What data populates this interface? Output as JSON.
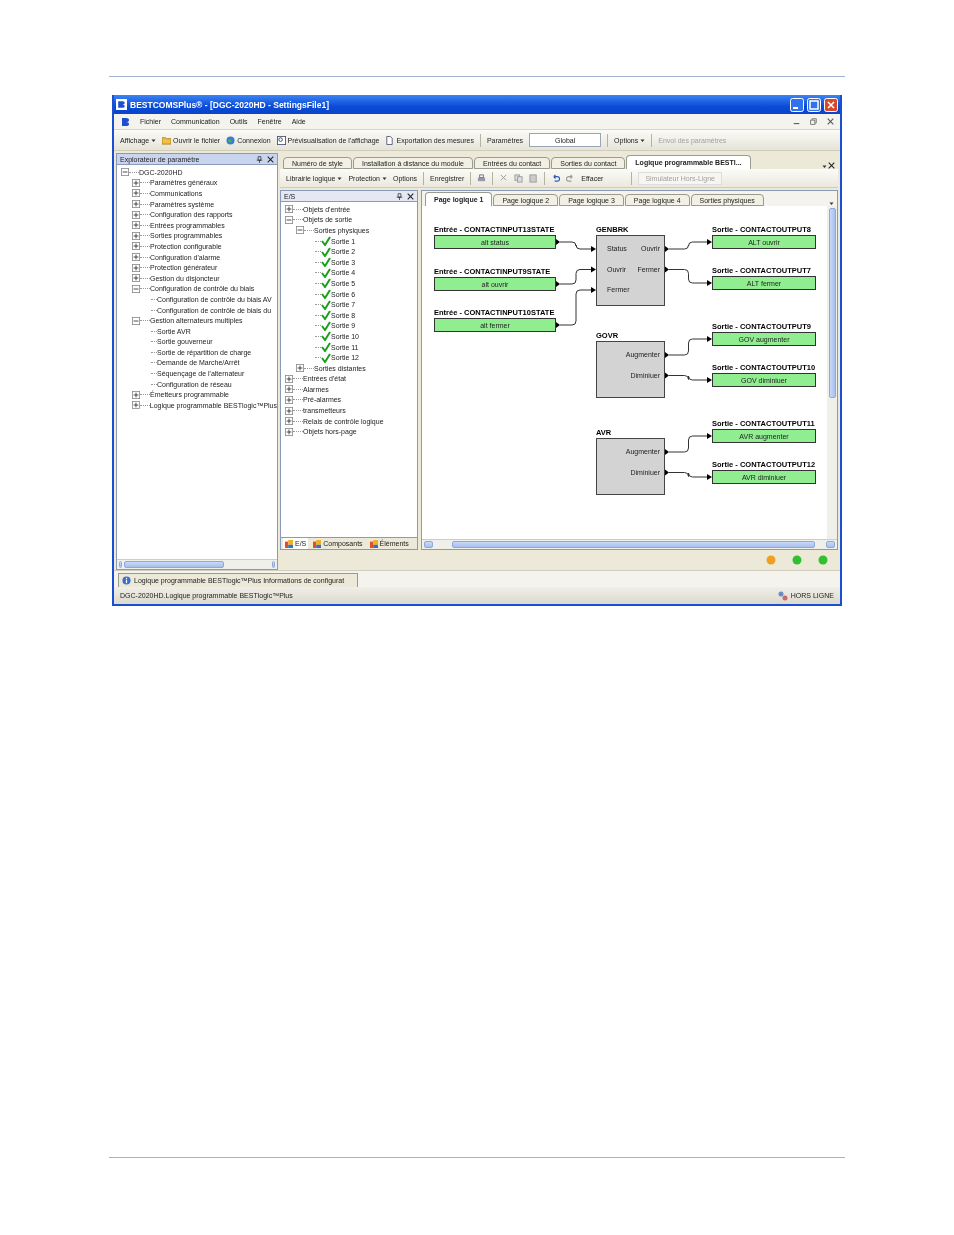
{
  "window": {
    "title": "BESTCOMSPlus® - [DGC-2020HD - SettingsFile1]"
  },
  "menu": [
    "Fichier",
    "Communication",
    "Outils",
    "Fenêtre",
    "Aide"
  ],
  "toolbar": [
    {
      "kind": "dropdown",
      "label": "Affichage"
    },
    {
      "kind": "button",
      "label": "Ouvrir le fichier"
    },
    {
      "kind": "button",
      "label": "Connexion"
    },
    {
      "kind": "button",
      "label": "Prévisualisation de l'affichage"
    },
    {
      "kind": "button",
      "label": "Exportation des mesures"
    },
    {
      "kind": "label",
      "label": "Paramètres"
    },
    {
      "kind": "field",
      "value": "Global"
    },
    {
      "kind": "dropdown",
      "label": "Options"
    },
    {
      "kind": "disabled",
      "label": "Envoi des paramètres"
    }
  ],
  "explorer": {
    "title": "Explorateur de paramètre",
    "tree": [
      {
        "label": "DGC-2020HD",
        "expanded": true,
        "children": [
          {
            "label": "Paramètres généraux",
            "expanded": false
          },
          {
            "label": "Communications",
            "expanded": false
          },
          {
            "label": "Paramètres système",
            "expanded": false
          },
          {
            "label": "Configuration des rapports",
            "expanded": false
          },
          {
            "label": "Entrées programmables",
            "expanded": false
          },
          {
            "label": "Sorties programmables",
            "expanded": false
          },
          {
            "label": "Protection configurable",
            "expanded": false
          },
          {
            "label": "Configuration d'alarme",
            "expanded": false
          },
          {
            "label": "Protection générateur",
            "expanded": false
          },
          {
            "label": "Gestion du disjoncteur",
            "expanded": false
          },
          {
            "label": "Configuration de contrôle du biais",
            "expanded": true,
            "children": [
              {
                "label": "Configuration de contrôle du biais AV"
              },
              {
                "label": "Configuration de contrôle de biais du"
              }
            ]
          },
          {
            "label": "Gestion alternateurs multiples",
            "expanded": true,
            "children": [
              {
                "label": "Sortie AVR"
              },
              {
                "label": "Sortie gouverneur"
              },
              {
                "label": "Sortie de répartition de charge"
              },
              {
                "label": "Demande de Marche/Arrêt"
              },
              {
                "label": "Séquençage de l'alternateur"
              },
              {
                "label": "Configuration de réseau"
              }
            ]
          },
          {
            "label": "Émetteurs programmable",
            "expanded": false
          },
          {
            "label": "Logique programmable BESTlogic™Plus",
            "expanded": false
          }
        ]
      }
    ]
  },
  "doc_tabs": [
    {
      "label": "Numéro de style",
      "selected": false
    },
    {
      "label": "Installation à distance du module",
      "selected": false
    },
    {
      "label": "Entrées du contact",
      "selected": false
    },
    {
      "label": "Sorties du contact",
      "selected": false
    },
    {
      "label": "Logique programmable BESTl...",
      "selected": true
    }
  ],
  "doc_toolbar": [
    {
      "kind": "dropdown",
      "label": "Librairie logique"
    },
    {
      "kind": "dropdown",
      "label": "Protection"
    },
    {
      "kind": "button",
      "label": "Options"
    },
    {
      "kind": "button",
      "label": "Enregistrer"
    },
    {
      "kind": "icons"
    },
    {
      "kind": "button",
      "label": "Effacer"
    },
    {
      "kind": "disabled",
      "label": "Simulateur Hors-Ligne"
    }
  ],
  "io_panel": {
    "title": "E/S",
    "tree": [
      {
        "label": "Objets d'entrée",
        "expanded": false
      },
      {
        "label": "Objets de sortie",
        "expanded": true,
        "children": [
          {
            "label": "Sorties physiques",
            "expanded": true,
            "children": [
              {
                "label": "Sortie 1",
                "kind": "output"
              },
              {
                "label": "Sortie 2",
                "kind": "output"
              },
              {
                "label": "Sortie 3",
                "kind": "output"
              },
              {
                "label": "Sortie 4",
                "kind": "output"
              },
              {
                "label": "Sortie 5",
                "kind": "output"
              },
              {
                "label": "Sortie 6",
                "kind": "output"
              },
              {
                "label": "Sortie 7",
                "kind": "output"
              },
              {
                "label": "Sortie 8",
                "kind": "output"
              },
              {
                "label": "Sortie 9",
                "kind": "output"
              },
              {
                "label": "Sortie 10",
                "kind": "output"
              },
              {
                "label": "Sortie 11",
                "kind": "output"
              },
              {
                "label": "Sortie 12",
                "kind": "output"
              }
            ]
          },
          {
            "label": "Sorties distantes",
            "expanded": false
          }
        ]
      },
      {
        "label": "Entrées d'état",
        "expanded": false
      },
      {
        "label": "Alarmes",
        "expanded": false
      },
      {
        "label": "Pré-alarmes",
        "expanded": false
      },
      {
        "label": "transmetteurs",
        "expanded": false
      },
      {
        "label": "Relais de contrôle logique",
        "expanded": false
      },
      {
        "label": "Objets hors-page",
        "expanded": false
      }
    ],
    "tabs": [
      {
        "label": "E/S",
        "selected": true
      },
      {
        "label": "Composants",
        "selected": false
      },
      {
        "label": "Éléments",
        "selected": false
      }
    ]
  },
  "page_tabs": [
    {
      "label": "Page logique 1",
      "selected": true
    },
    {
      "label": "Page logique 2",
      "selected": false
    },
    {
      "label": "Page logique 3",
      "selected": false
    },
    {
      "label": "Page logique 4",
      "selected": false
    },
    {
      "label": "Sorties physiques",
      "selected": false
    }
  ],
  "diagram": {
    "inputs": [
      {
        "heading": "Entrée - CONTACTINPUT13STATE",
        "label": "alt status"
      },
      {
        "heading": "Entrée - CONTACTINPUT9STATE",
        "label": "alt ouvrir"
      },
      {
        "heading": "Entrée - CONTACTINPUT10STATE",
        "label": "alt fermer"
      }
    ],
    "blocks": [
      {
        "name": "GENBRK",
        "inputs": [
          "Status",
          "Ouvrir",
          "Fermer"
        ],
        "outputs": [
          "Ouvrir",
          "Fermer"
        ]
      },
      {
        "name": "GOVR",
        "outputs": [
          "Augmenter",
          "Diminiuer"
        ]
      },
      {
        "name": "AVR",
        "outputs": [
          "Augmenter",
          "Diminiuer"
        ]
      }
    ],
    "outputs": [
      {
        "heading": "Sortie - CONTACTOUTPUT8",
        "label": "ALT ouvrir"
      },
      {
        "heading": "Sortie - CONTACTOUTPUT7",
        "label": "ALT fermer"
      },
      {
        "heading": "Sortie - CONTACTOUTPUT9",
        "label": "GOV augmenter"
      },
      {
        "heading": "Sortie - CONTACTOUTPUT10",
        "label": "GOV diminiuer"
      },
      {
        "heading": "Sortie - CONTACTOUTPUT11",
        "label": "AVR augmenter"
      },
      {
        "heading": "Sortie - CONTACTOUTPUT12",
        "label": "AVR diminiuer"
      }
    ]
  },
  "lights": [
    {
      "color": "#f0a020"
    },
    {
      "color": "#30c030"
    },
    {
      "color": "#30c030"
    }
  ],
  "info_tab": "Logique programmable BESTlogic™Plus Informations de configurat",
  "status_bar": {
    "path": "DGC-2020HD.Logique programmable BESTlogic™Plus",
    "mode": "HORS LIGNE"
  }
}
